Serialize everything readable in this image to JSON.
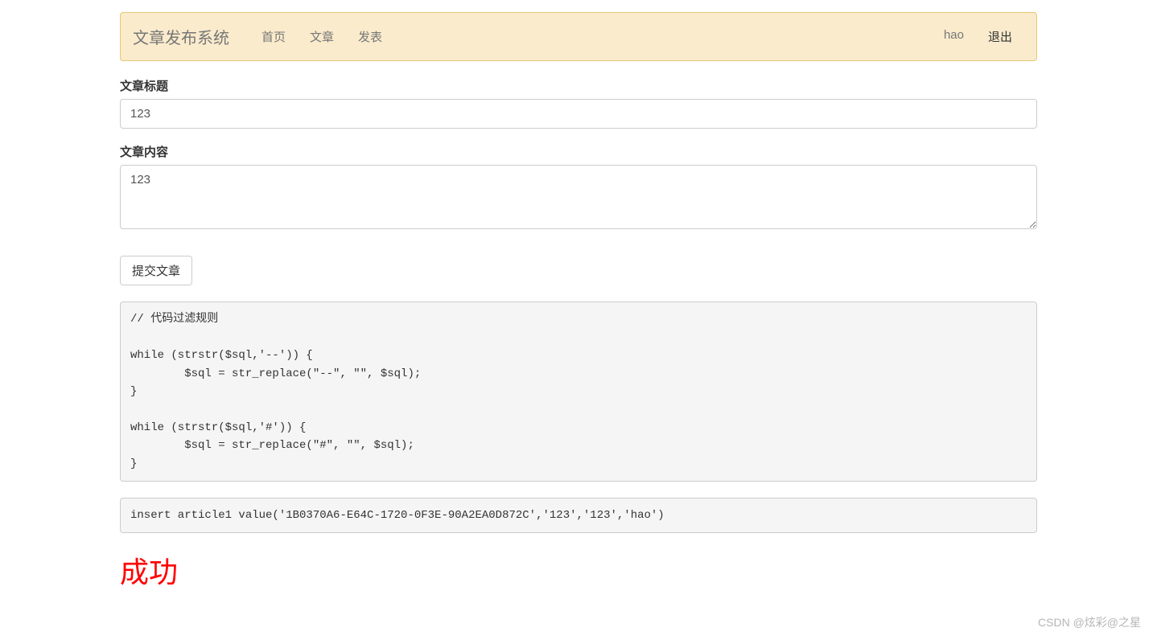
{
  "navbar": {
    "brand": "文章发布系统",
    "items": [
      {
        "label": "首页"
      },
      {
        "label": "文章"
      },
      {
        "label": "发表"
      }
    ],
    "right": {
      "username": "hao",
      "logout": "退出"
    }
  },
  "form": {
    "title_label": "文章标题",
    "title_value": "123",
    "content_label": "文章内容",
    "content_value": "123",
    "submit_label": "提交文章"
  },
  "code_block": "// 代码过滤规则\n\nwhile (strstr($sql,'--')) {\n        $sql = str_replace(\"--\", \"\", $sql);\n}\n\nwhile (strstr($sql,'#')) {\n        $sql = str_replace(\"#\", \"\", $sql);\n}",
  "sql_block": "insert article1 value('1B0370A6-E64C-1720-0F3E-90A2EA0D872C','123','123','hao')",
  "success_text": "成功",
  "watermark": "CSDN @炫彩@之星"
}
